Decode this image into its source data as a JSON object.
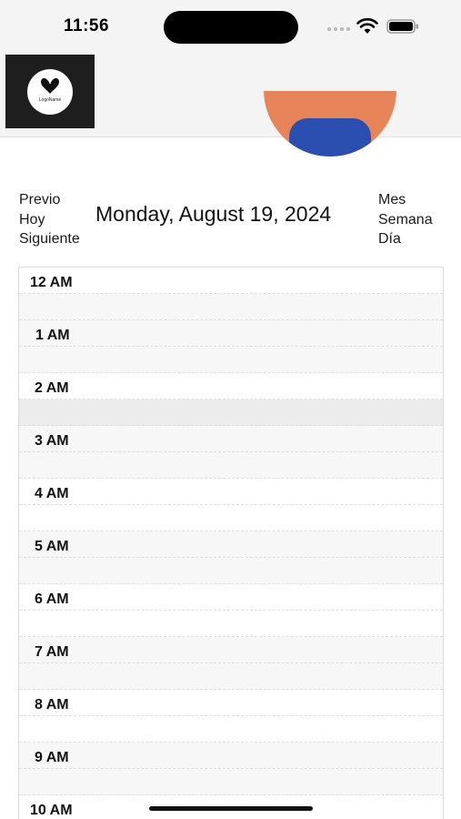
{
  "status_bar": {
    "time": "11:56"
  },
  "header": {
    "logo_text": "LogoName"
  },
  "nav": {
    "prev_label": "Previo",
    "today_label": "Hoy",
    "next_label": "Siguiente",
    "month_label": "Mes",
    "week_label": "Semana",
    "day_label": "Día"
  },
  "date_title": "Monday, August 19, 2024",
  "calendar": {
    "hours": [
      "12 AM",
      "1 AM",
      "2 AM",
      "3 AM",
      "4 AM",
      "5 AM",
      "6 AM",
      "7 AM",
      "8 AM",
      "9 AM",
      "10 AM"
    ]
  },
  "colors": {
    "selected_slot": "#ececec",
    "avatar_shirt": "#2a4fb0"
  }
}
